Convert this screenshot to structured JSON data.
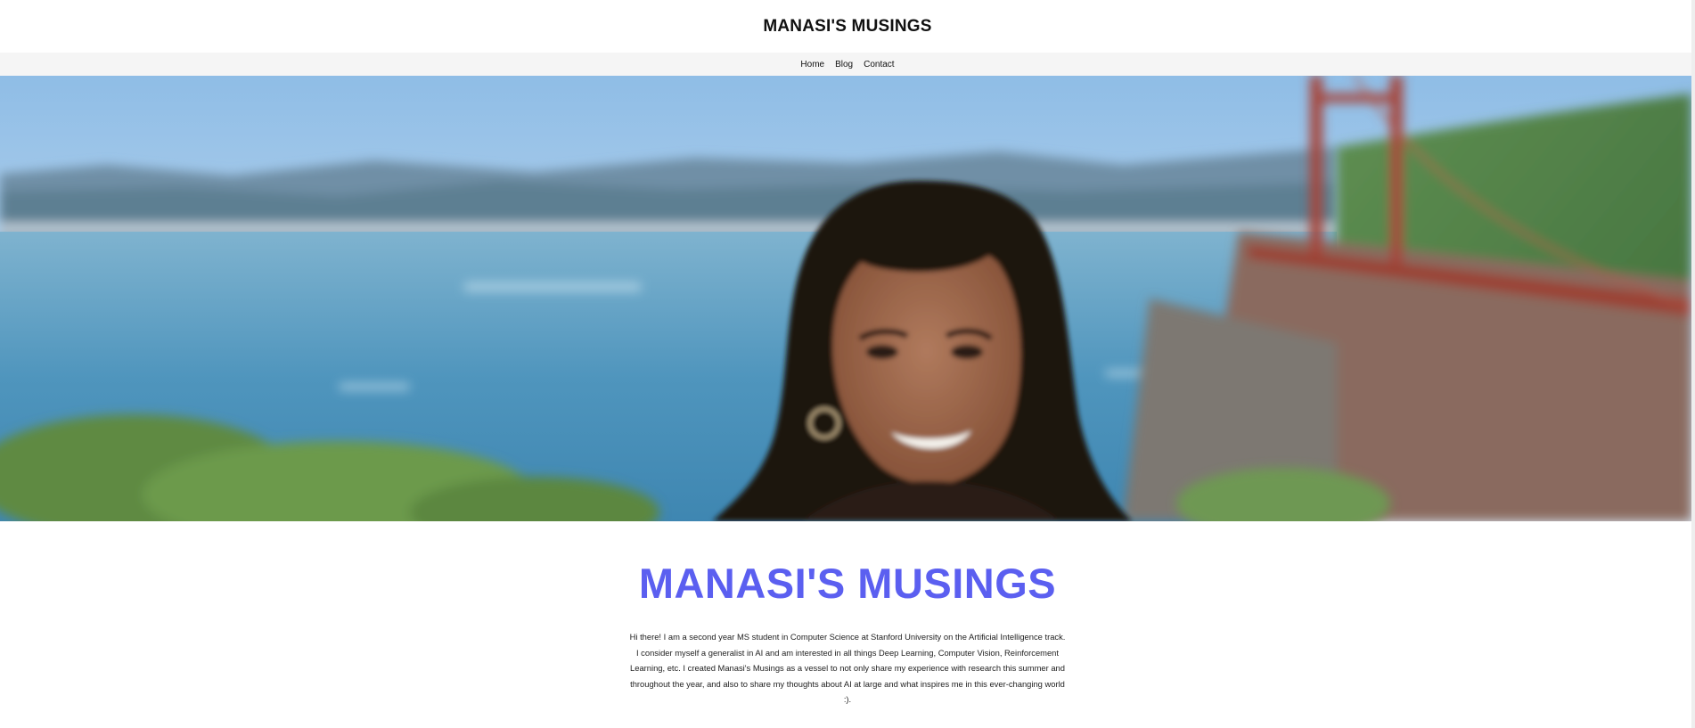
{
  "header": {
    "site_title": "MANASI'S MUSINGS"
  },
  "nav": {
    "items": [
      {
        "label": "Home"
      },
      {
        "label": "Blog"
      },
      {
        "label": "Contact"
      }
    ]
  },
  "hero": {
    "icon": "portrait-photo"
  },
  "main": {
    "title": "MANASI'S MUSINGS",
    "bio": "Hi there! I am a second year MS student in Computer Science at Stanford University on the Artificial Intelligence track. I consider myself a generalist in AI and am interested in all things Deep Learning, Computer Vision, Reinforcement Learning, etc. I created Manasi's Musings as a vessel to not only share my experience with research this summer and throughout the year, and also to share my thoughts about AI at large and what inspires me in this ever-changing world :)."
  },
  "colors": {
    "accent": "#5b5ff0",
    "nav_bg": "#f5f5f5"
  }
}
